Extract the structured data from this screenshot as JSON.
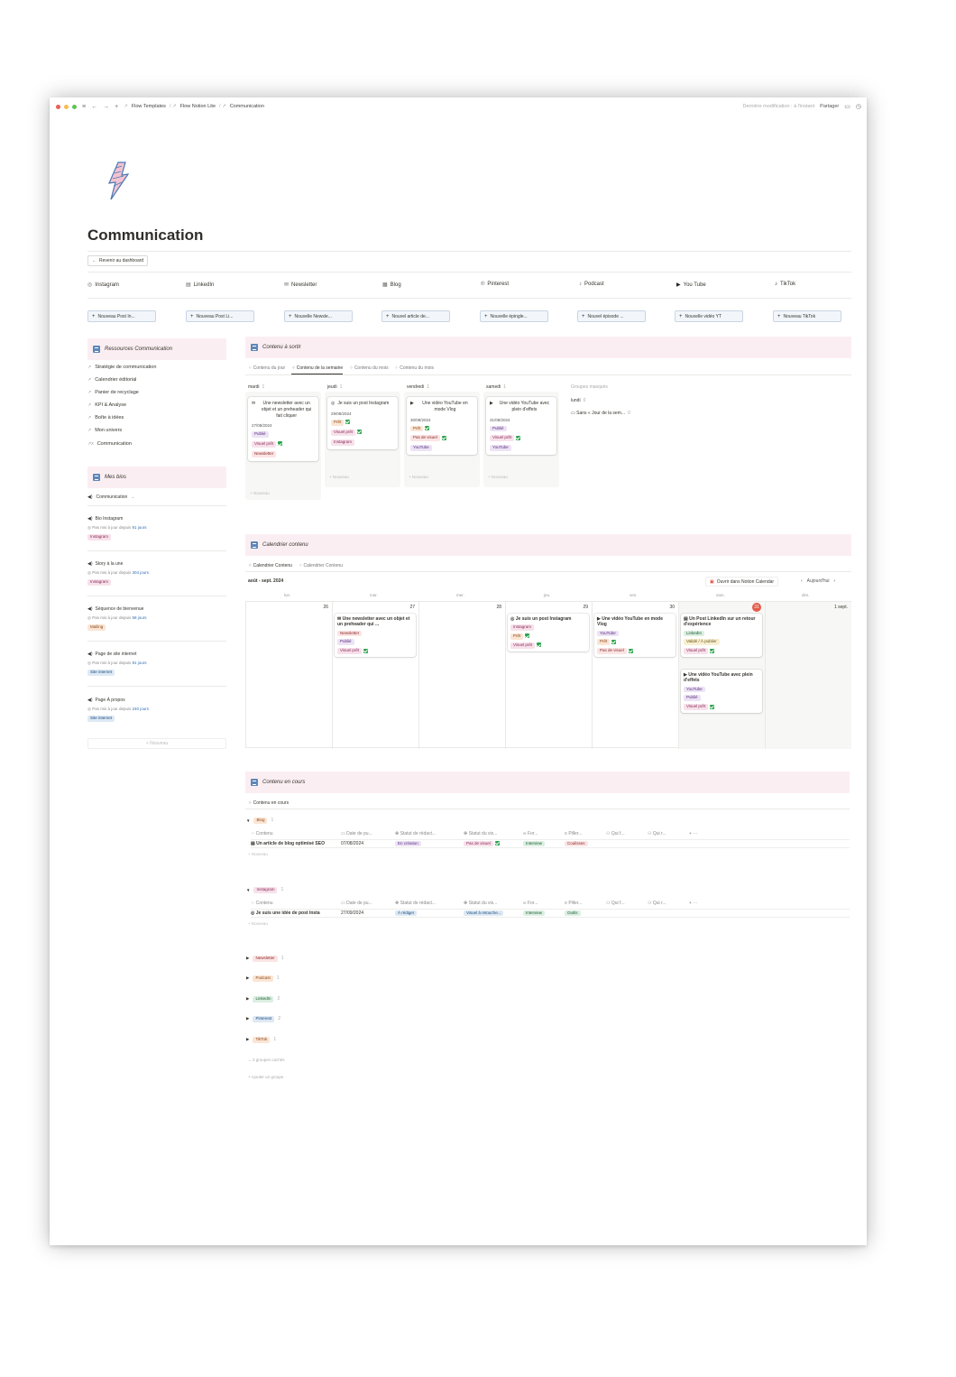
{
  "topbar": {
    "breadcrumbs": [
      "Flow Templates",
      "Flow Notion Lite",
      "Communication"
    ],
    "last_modified": "Dernière modification : à l'instant",
    "share_label": "Partager"
  },
  "page": {
    "title": "Communication",
    "back_button": "Revenir au dashboard"
  },
  "nav_links": [
    {
      "label": "Instagram",
      "icon": "instagram-icon",
      "glyph": "◎"
    },
    {
      "label": "LinkedIn",
      "icon": "linkedin-icon",
      "glyph": "▤"
    },
    {
      "label": "Newsletter",
      "icon": "newsletter-icon",
      "glyph": "✉"
    },
    {
      "label": "Blog",
      "icon": "blog-icon",
      "glyph": "▦"
    },
    {
      "label": "Pinterest",
      "icon": "pinterest-icon",
      "glyph": "℗"
    },
    {
      "label": "Podcast",
      "icon": "podcast-icon",
      "glyph": "♪"
    },
    {
      "label": "You Tube",
      "icon": "youtube-icon",
      "glyph": "▶"
    },
    {
      "label": "TikTok",
      "icon": "tiktok-icon",
      "glyph": "♪"
    }
  ],
  "new_buttons": [
    "Nouveau Post In...",
    "Nouveau Post Li...",
    "Nouvelle Newsle...",
    "Nouvel article de...",
    "Nouvelle épingle...",
    "Nouvel épisode ...",
    "Nouvelle vidéo YT",
    "Nouveau TikTok"
  ],
  "resources": {
    "header": "Ressources Communication",
    "links": [
      "Stratégie de communication",
      "Calendrier éditorial",
      "Panier de recyclage",
      "KPI & Analyse",
      "Boîte à idées",
      "Mon univers",
      "Communication"
    ]
  },
  "bios": {
    "header": "Mes bios",
    "view_label": "Communication",
    "items": [
      {
        "title": "Bio Instagram",
        "sub": "Pas mis à jour depuis",
        "days": "91 jours",
        "tag": "Instagram"
      },
      {
        "title": "Story à la une",
        "sub": "Pas mis à jour depuis",
        "days": "304 jours",
        "tag": "Instagram"
      },
      {
        "title": "Séquence de bienvenue",
        "sub": "Pas mis à jour depuis",
        "days": "58 jours",
        "tag": "Mailing"
      },
      {
        "title": "Page de site internet",
        "sub": "Pas mis à jour depuis",
        "days": "91 jours",
        "tag": "Site internet"
      },
      {
        "title": "Page À propos",
        "sub": "Pas mis à jour depuis",
        "days": "240 jours",
        "tag": "Site internet"
      }
    ],
    "new_label": "+ Nouveau"
  },
  "to_publish": {
    "header": "Contenu à sortir",
    "tabs": [
      "Contenu du jour",
      "Contenu de la semaine",
      "Contenu du mois",
      "Contenu du mois"
    ],
    "columns": [
      {
        "day": "mardi",
        "count": "1",
        "card": {
          "title": "Une newsletter avec un objet et un preheader qui fait cliquer",
          "date": "27/08/2024",
          "tags": [
            "Publié",
            "Visuel prêt",
            "Newsletter"
          ]
        }
      },
      {
        "day": "jeudi",
        "count": "1",
        "card": {
          "title": "Je suis un post Instagram",
          "date": "29/08/2024",
          "tags": [
            "Prêt",
            "Visuel prêt",
            "Instagram"
          ]
        }
      },
      {
        "day": "vendredi",
        "count": "1",
        "card": {
          "title": "Une vidéo YouTube en mode Vlog",
          "date": "30/08/2024",
          "tags": [
            "Prêt",
            "Pas de visuel",
            "YouTube"
          ]
        }
      },
      {
        "day": "samedi",
        "count": "1",
        "card": {
          "title": "Une vidéo YouTube avec plein d'effets",
          "date": "31/08/2024",
          "tags": [
            "Publié",
            "Visuel prêt",
            "YouTube"
          ]
        }
      }
    ],
    "hidden_label": "Groupes masqués",
    "hidden_groups": [
      {
        "name": "lundi",
        "count": "0"
      },
      {
        "name": "Sans « Jour de la sem...",
        "count": "0"
      }
    ],
    "new_label": "+ Nouveau"
  },
  "calendar": {
    "header": "Calendrier contenu",
    "tabs": [
      "Calendrier Contenu",
      "Calendrier Contenu"
    ],
    "month": "août - sept. 2024",
    "open_btn": "Ouvrir dans Notion Calendar",
    "today_btn": "Aujourd'hui",
    "weekdays": [
      "lun.",
      "mar.",
      "mer.",
      "jeu.",
      "ven.",
      "sam.",
      "dim."
    ],
    "days": [
      "26",
      "27",
      "28",
      "29",
      "30",
      "31",
      "1 sept."
    ],
    "events": [
      {
        "title": "Une newsletter avec un objet et un preheader qui ...",
        "tags": [
          "Newsletter",
          "Publié",
          "Visuel prêt"
        ]
      },
      {
        "title": "Je suis un post Instagram",
        "tags": [
          "Instagram",
          "Prêt",
          "Visuel prêt"
        ]
      },
      {
        "title": "Une vidéo YouTube en mode Vlog",
        "tags": [
          "YouTube",
          "Prêt",
          "Pas de visuel"
        ]
      },
      {
        "title": "Un Post LinkedIn sur un retour d'expérience",
        "tags": [
          "LinkedIn",
          "Validé / À publier",
          "Visuel prêt"
        ]
      },
      {
        "title": "Une vidéo YouTube avec plein d'effets",
        "tags": [
          "YouTube",
          "Publié",
          "Visuel prêt"
        ]
      }
    ]
  },
  "in_progress": {
    "header": "Contenu en cours",
    "view_label": "Contenu en cours",
    "columns": [
      "Contenu",
      "Date de pu...",
      "Statut de rédact...",
      "Statut du vis...",
      "For...",
      "Piller...",
      "Qui f...",
      "Qui r..."
    ],
    "groups": [
      {
        "name": "Blog",
        "count": "1",
        "row": {
          "title": "Un article de blog optimisé SEO",
          "date": "07/08/2024",
          "status": "En création",
          "visual": "Pas de visuel",
          "format": "Interview",
          "pillar": "Coulisses"
        }
      },
      {
        "name": "Instagram",
        "count": "1",
        "row": {
          "title": "Je suis une idée de post Insta",
          "date": "27/09/2024",
          "status": "À rédiger",
          "visual": "Visuel à retouche...",
          "format": "Interview",
          "pillar": "Outils"
        }
      }
    ],
    "collapsed_groups": [
      {
        "name": "Newsletter",
        "count": "1"
      },
      {
        "name": "Podcast",
        "count": "1"
      },
      {
        "name": "LinkedIn",
        "count": "2"
      },
      {
        "name": "Pinterest",
        "count": "2"
      },
      {
        "name": "TikTok",
        "count": "1"
      }
    ],
    "hidden_groups": "2 groupes cachés",
    "add_group": "Ajouter un groupe",
    "new_label": "+ Nouveau"
  }
}
